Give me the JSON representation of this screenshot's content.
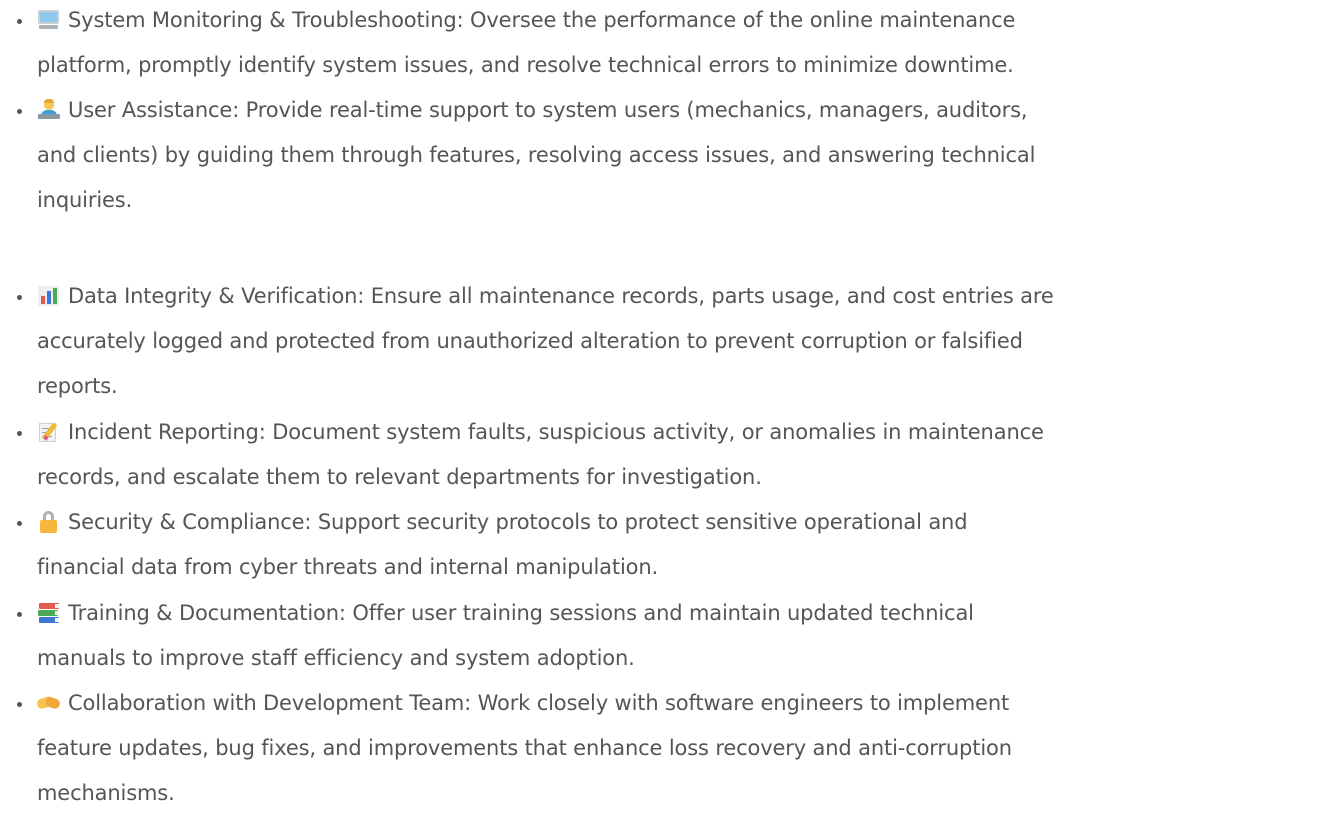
{
  "items": [
    {
      "icon": "computer-icon",
      "lines": [
        "System Monitoring & Troubleshooting: Oversee the performance of the online maintenance",
        "platform, promptly identify system issues, and resolve technical errors to minimize downtime."
      ]
    },
    {
      "icon": "technologist-icon",
      "lines": [
        "User Assistance: Provide real-time support to system users (mechanics, managers, auditors,",
        "and clients) by guiding them through features, resolving access issues, and answering technical",
        "inquiries."
      ]
    },
    {
      "icon": "bar-chart-icon",
      "lines": [
        "Data Integrity & Verification: Ensure all maintenance records, parts usage, and cost entries are",
        "accurately logged and protected from unauthorized alteration to prevent corruption or falsified",
        "reports."
      ]
    },
    {
      "icon": "memo-icon",
      "lines": [
        "Incident Reporting: Document system faults, suspicious activity, or anomalies in maintenance",
        "records, and escalate them to relevant departments for investigation."
      ]
    },
    {
      "icon": "lock-icon",
      "lines": [
        "Security & Compliance: Support security protocols to protect sensitive operational and",
        "financial data from cyber threats and internal manipulation."
      ]
    },
    {
      "icon": "books-icon",
      "lines": [
        "Training & Documentation: Offer user training sessions and maintain updated technical",
        "manuals to improve staff efficiency and system adoption."
      ]
    },
    {
      "icon": "handshake-icon",
      "lines": [
        "Collaboration with Development Team: Work closely with software engineers to implement",
        "feature updates, bug fixes, and improvements that enhance loss recovery and anti-corruption",
        "mechanisms."
      ]
    }
  ]
}
